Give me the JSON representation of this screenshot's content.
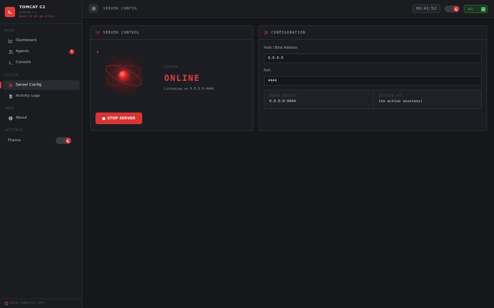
{
  "brand": {
    "name": "TOMCAT C2",
    "version": "VERSION 1.2",
    "tagline": "READY TO GET AN ATTACK"
  },
  "sidebar": {
    "sections": {
      "main": "MAIN",
      "system": "SYSTEM",
      "info": "INFO",
      "settings": "SETTINGS"
    },
    "items": {
      "dashboard": "Dashboard",
      "agents": "Agents",
      "agents_badge": "1",
      "console": "Console",
      "server_config": "Server Config",
      "activity_logs": "Activity Logs",
      "about": "About",
      "theme": "Theme"
    },
    "footer": "2026 TOMCATC2 OPS"
  },
  "topbar": {
    "title": "SERVER CONFIG",
    "clock": "06:41:52",
    "api_label": "API"
  },
  "server_control": {
    "header": "SERVER CONTROL",
    "status_label": "STATUS",
    "status_value": "ONLINE",
    "listening": "Listening on 0.0.0.0:4444",
    "stop_button": "STOP SERVER"
  },
  "configuration": {
    "header": "CONFIGURATION",
    "host_label": "Host / Bind Address",
    "host_value": "0.0.0.0",
    "port_label": "Port",
    "port_value": "4444",
    "bound_label": "BOUND ADDRESS",
    "bound_value": "0.0.0.0:4444",
    "session_label": "SESSION APT",
    "session_value": "(no active sessions)"
  },
  "colors": {
    "accent": "#e03a3a",
    "background": "#16171b",
    "panel": "#1c1d22",
    "api_ok": "#3aa84a"
  }
}
